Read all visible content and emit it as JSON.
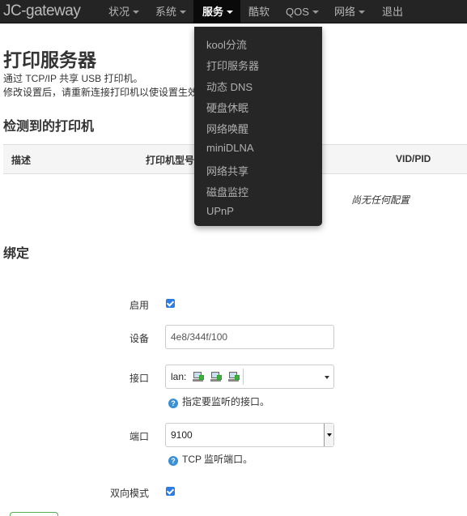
{
  "nav": {
    "brand": "JC-gateway",
    "items": [
      {
        "label": "状况",
        "caret": true
      },
      {
        "label": "系统",
        "caret": true
      },
      {
        "label": "服务",
        "caret": true,
        "active": true
      },
      {
        "label": "酷软",
        "caret": false
      },
      {
        "label": "QOS",
        "caret": true
      },
      {
        "label": "网络",
        "caret": true
      },
      {
        "label": "退出",
        "caret": false
      }
    ]
  },
  "dropdown": {
    "items": [
      "kool分流",
      "打印服务器",
      "动态 DNS",
      "硬盘休眠",
      "网络唤醒",
      "miniDLNA",
      "网络共享",
      "磁盘监控",
      "UPnP"
    ]
  },
  "page": {
    "title": "打印服务器",
    "desc1": "通过 TCP/IP 共享 USB 打印机。",
    "desc2": "修改设置后，请重新连接打印机以使设置生效。"
  },
  "detected": {
    "heading": "检测到的打印机",
    "columns": [
      "描述",
      "打印机型号",
      "VID/PID"
    ],
    "empty": "尚无任何配置"
  },
  "binding": {
    "heading": "绑定",
    "enable_label": "启用",
    "device_label": "设备",
    "device_value": "4e8/344f/100",
    "interface_label": "接口",
    "interface_value": "lan:",
    "interface_help": "指定要监听的接口。",
    "port_label": "端口",
    "port_value": "9100",
    "port_help": "TCP 监听端口。",
    "bidir_label": "双向模式"
  }
}
